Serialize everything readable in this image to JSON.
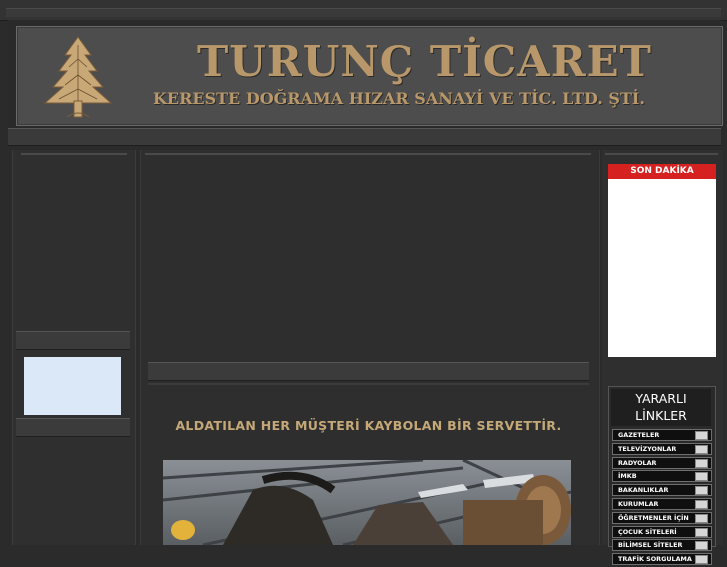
{
  "header": {
    "title": "TURUNÇ TİCARET",
    "subtitle": "KERESTE DOĞRAMA HIZAR SANAYİ VE TİC. LTD. ŞTİ.",
    "logo_icon": "pine-tree-icon"
  },
  "main": {
    "slogan": "ALDATILAN HER MÜŞTERİ KAYBOLAN BİR SERVETTİR."
  },
  "news": {
    "heading": "SON DAKİKA"
  },
  "links": {
    "title_line1": "YARARLI",
    "title_line2": "LİNKLER",
    "items": [
      "GAZETELER",
      "TELEVİZYONLAR",
      "RADYOLAR",
      "İMKB",
      "BAKANLIKLAR",
      "KURUMLAR",
      "ÖĞRETMENLER İÇİN",
      "ÇOCUK SİTELERİ",
      "BİLİMSEL SİTELER",
      "TRAFİK SORGULAMA"
    ]
  },
  "colors": {
    "accent_gold": "#b8986a",
    "news_red": "#d62121",
    "background": "#2b2b2b"
  }
}
